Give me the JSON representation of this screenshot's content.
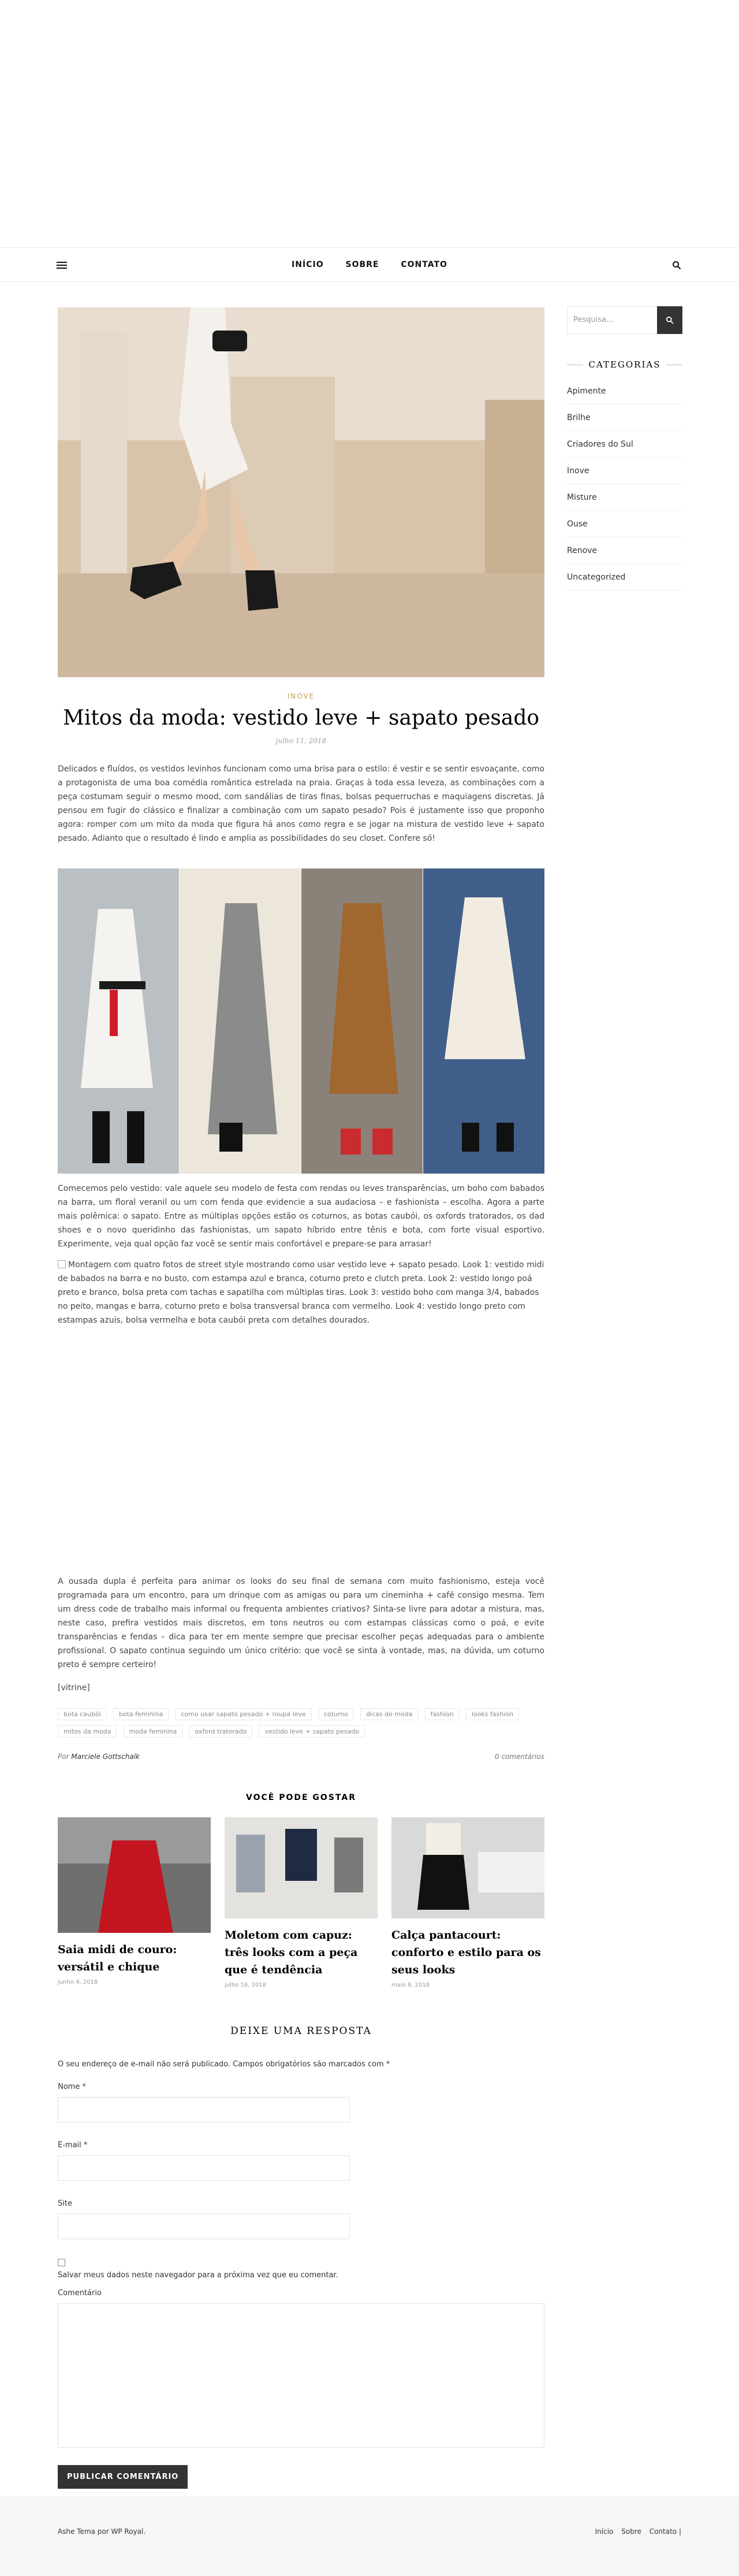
{
  "nav": {
    "items": [
      "INÍCIO",
      "SOBRE",
      "CONTATO"
    ]
  },
  "post": {
    "category": "INOVE",
    "title": "Mitos da moda: vestido leve + sapato pesado",
    "date": "julho 11, 2018",
    "intro": "Delicados e fluídos, os vestidos levinhos funcionam como uma brisa para o estilo: é vestir e se sentir esvoaçante, como a protagonista de uma boa comédia romântica estrelada na praia. Graças à toda essa leveza, as combinações com a peça costumam seguir o mesmo mood, com sandálias de tiras finas, bolsas pequerruchas e maquiagens discretas. Já pensou em fugir do clássico e finalizar a combinação com um sapato pesado? Pois é justamente isso que proponho agora: romper com um mito da moda que figura há anos como regra e se jogar na mistura de vestido leve + sapato pesado. Adianto que o resultado é lindo e amplia as possibilidades do seu closet. Confere só!",
    "body2": "Comecemos pelo vestido: vale aquele seu modelo de festa com rendas ou leves transparências, um boho com babados na barra, um floral veranil ou um com fenda que evidencie a sua audaciosa – e fashionista – escolha. Agora a parte mais polêmica: o sapato. Entre as múltiplas opções estão os coturnos, as botas caubói, os oxfords tratorados, os dad shoes e o novo queridinho das fashionistas, um sapato híbrido entre tênis e bota, com forte visual esportivo. Experimente, veja qual opção faz você se sentir mais confortável e prepare-se para arrasar!",
    "alt_text": "Montagem com quatro fotos de street style mostrando como usar vestido leve + sapato pesado. Look 1: vestido midi de babados na barra e no busto, com estampa azul e branca, coturno preto e clutch preta. Look 2: vestido longo poá preto e branco, bolsa preta com tachas e sapatilha com múltiplas tiras. Look 3: vestido boho com manga 3/4, babados no peito, mangas e barra, coturno preto e bolsa transversal branca com vermelho. Look 4: vestido longo preto com estampas azuis, bolsa vermelha e bota caubói preta com detalhes dourados.",
    "body3": "A ousada dupla é perfeita para animar os looks do seu final de semana com muito fashionismo, esteja você programada para um encontro, para um drinque com as amigas ou para um cineminha + café consigo mesma. Tem um dress code de trabalho mais informal ou frequenta ambientes criativos? Sinta-se livre para adotar a mistura, mas, neste caso, prefira vestidos mais discretos, em tons neutros ou com estampas clássicas como o poá, e evite transparências e fendas – dica para ter em mente sempre que precisar escolher peças adequadas para o ambiente profissional. O sapato continua seguindo um único critério: que você se sinta à vontade, mas, na dúvida, um coturno preto é sempre certeiro!",
    "vitrine": "[vitrine]",
    "tags": [
      "bota caubói",
      "bota feminina",
      "como usar sapato pesado + roupa leve",
      "coturno",
      "dicas de moda",
      "fashion",
      "looks fashion",
      "mitos da moda",
      "moda feminina",
      "oxford tratorado",
      "vestido leve + sapato pesado"
    ],
    "author_prefix": "Por",
    "author": "Marciele Gottschalk",
    "comments": "0 comentários"
  },
  "related": {
    "heading": "VOCÊ PODE GOSTAR",
    "items": [
      {
        "title": "Saia midi de couro: versátil e chique",
        "date": "junho 4, 2018"
      },
      {
        "title": "Moletom com capuz: três looks com a peça que é tendência",
        "date": "julho 16, 2018"
      },
      {
        "title": "Calça pantacourt: conforto e estilo para os seus looks",
        "date": "maio 8, 2018"
      }
    ]
  },
  "reply": {
    "heading": "DEIXE UMA RESPOSTA",
    "note": "O seu endereço de e-mail não será publicado. Campos obrigatórios são marcados com *",
    "name_label": "Nome *",
    "email_label": "E-mail *",
    "site_label": "Site",
    "save_label": "Salvar meus dados neste navegador para a próxima vez que eu comentar.",
    "comment_label": "Comentário",
    "submit": "PUBLICAR COMENTÁRIO"
  },
  "sidebar": {
    "search_placeholder": "Pesquisa...",
    "categories_heading": "CATEGORIAS",
    "categories": [
      "Apimente",
      "Brilhe",
      "Criadores do Sul",
      "Inove",
      "Misture",
      "Ouse",
      "Renove",
      "Uncategorized"
    ]
  },
  "footer": {
    "credit": "Ashe Tema por WP Royal.",
    "links": [
      "Início",
      "Sobre",
      "Contato |"
    ]
  },
  "colors": {
    "accent": "#ca9b52",
    "button": "#333333",
    "footer_bg": "#f6f6f6"
  }
}
